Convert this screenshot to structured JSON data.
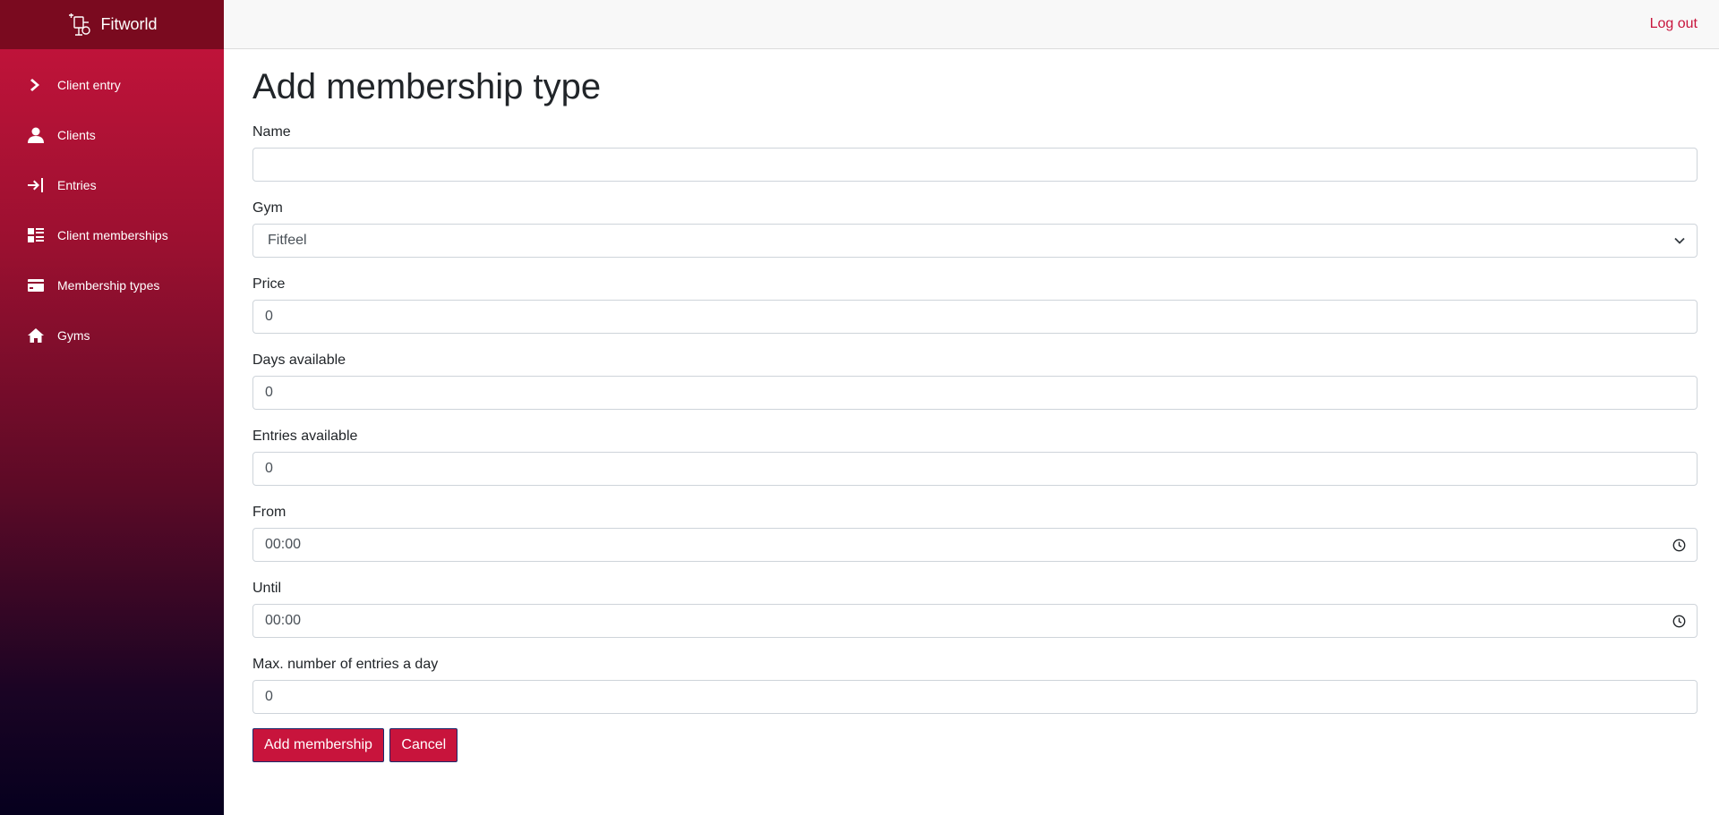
{
  "app": {
    "name": "Fitworld"
  },
  "sidebar": {
    "items": [
      {
        "label": "Client entry",
        "icon": "chevron-right-icon"
      },
      {
        "label": "Clients",
        "icon": "user-icon"
      },
      {
        "label": "Entries",
        "icon": "sign-in-icon"
      },
      {
        "label": "Client memberships",
        "icon": "dashboard-list-icon"
      },
      {
        "label": "Membership types",
        "icon": "credit-card-icon"
      },
      {
        "label": "Gyms",
        "icon": "home-icon"
      }
    ]
  },
  "header": {
    "logout_label": "Log out"
  },
  "main": {
    "title": "Add membership type",
    "fields": {
      "name": {
        "label": "Name",
        "value": ""
      },
      "gym": {
        "label": "Gym",
        "value": "Fitfeel"
      },
      "price": {
        "label": "Price",
        "value": "0"
      },
      "days": {
        "label": "Days available",
        "value": "0"
      },
      "entries": {
        "label": "Entries available",
        "value": "0"
      },
      "from": {
        "label": "From",
        "value": "00:00"
      },
      "until": {
        "label": "Until",
        "value": "00:00"
      },
      "max": {
        "label": "Max. number of entries a day",
        "value": "0"
      }
    },
    "buttons": {
      "add_label": "Add membership",
      "cancel_label": "Cancel"
    }
  },
  "colors": {
    "accent": "#c8143c",
    "brand_bar": "#7a0a1f"
  }
}
